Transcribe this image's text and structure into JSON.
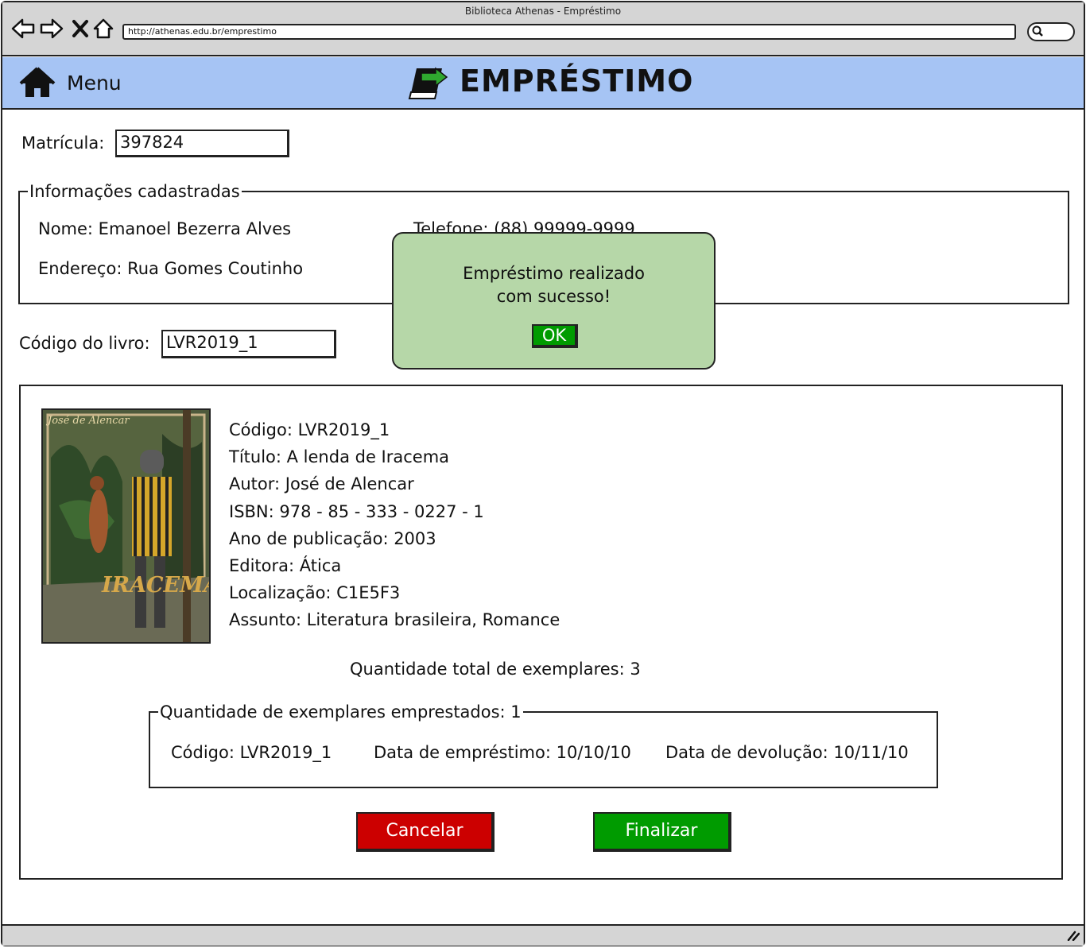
{
  "window": {
    "title": "Biblioteca Athenas - Empréstimo"
  },
  "browser": {
    "url": "http://athenas.edu.br/emprestimo",
    "nav_icons": [
      "back-icon",
      "forward-icon",
      "close-icon",
      "home-icon"
    ]
  },
  "header": {
    "menu_label": "Menu",
    "title": "EMPRÉSTIMO",
    "colors": {
      "background": "#a6c4f4",
      "icon_arrow": "#2fa82f"
    }
  },
  "form": {
    "matricula_label": "Matrícula:",
    "matricula_value": "397824",
    "book_code_label": "Código do livro:",
    "book_code_value": "LVR2019_1"
  },
  "registered_info": {
    "legend": "Informações cadastradas",
    "nome": "Nome: Emanoel Bezerra Alves",
    "telefone": "Telefone: (88) 99999-9999",
    "endereco": "Endereço: Rua Gomes Coutinho"
  },
  "book": {
    "cover_author": "José de Alencar",
    "cover_title": "IRACEMA",
    "lines": [
      "Código: LVR2019_1",
      "Título: A lenda de Iracema",
      "Autor: José de Alencar",
      "ISBN: 978 - 85 - 333 - 0227 - 1",
      "Ano de publicação: 2003",
      "Editora: Ática",
      "Localização: C1E5F3",
      "Assunto: Literatura brasileira, Romance"
    ],
    "total_copies": "Quantidade total de exemplares: 3"
  },
  "loans": {
    "legend": "Quantidade de exemplares emprestados: 1",
    "codigo": "Código: LVR2019_1",
    "data_emprestimo": "Data de empréstimo: 10/10/10",
    "data_devolucao": "Data de devolução: 10/11/10"
  },
  "actions": {
    "cancel_label": "Cancelar",
    "finish_label": "Finalizar",
    "cancel_color": "#cc0000",
    "finish_color": "#009b00"
  },
  "dialog": {
    "message_line1": "Empréstimo realizado",
    "message_line2": "com sucesso!",
    "ok_label": "OK",
    "background": "#b6d7a8"
  }
}
